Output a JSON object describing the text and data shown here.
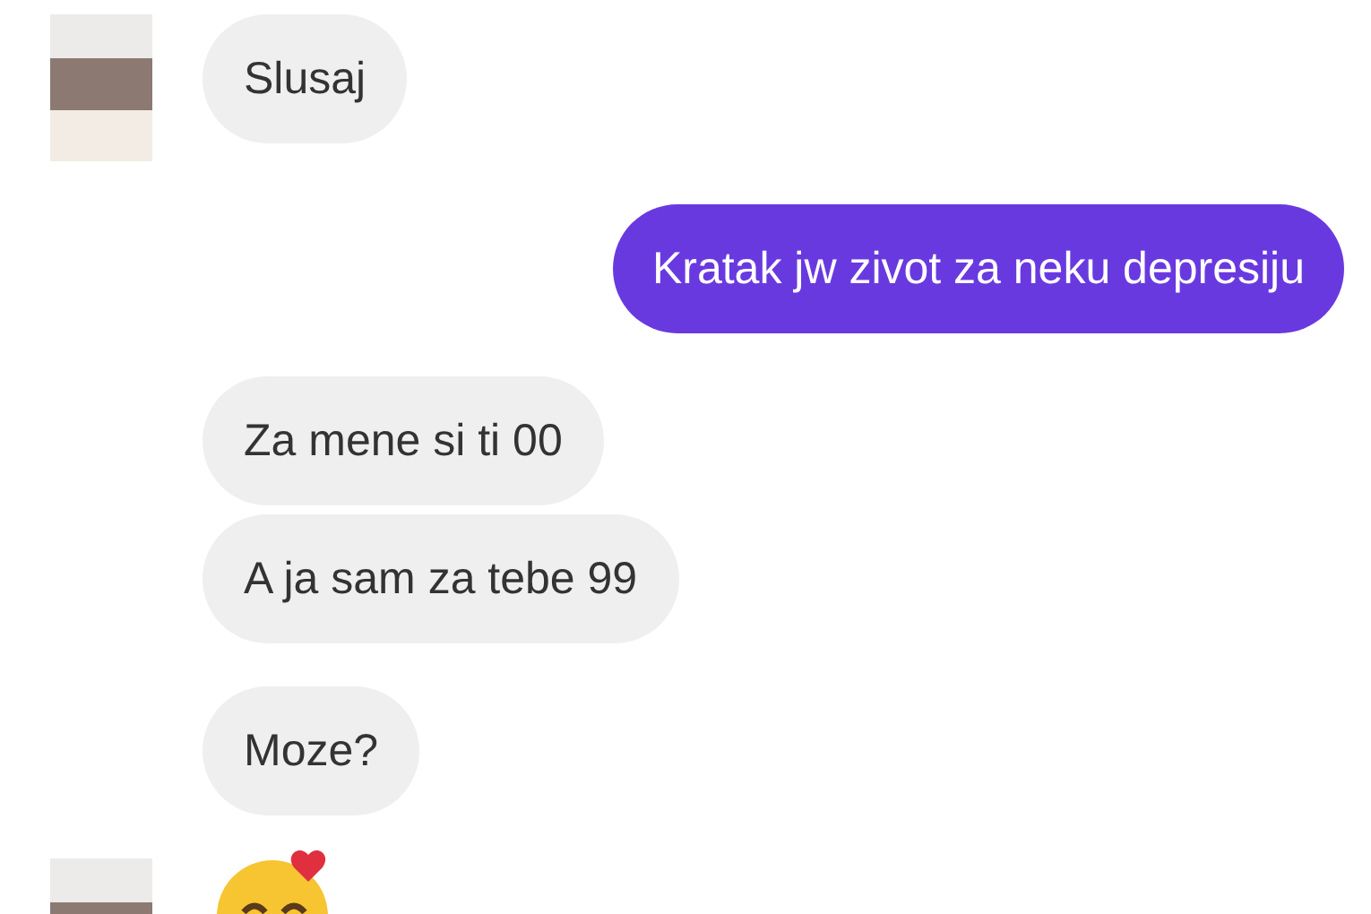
{
  "groups": [
    {
      "kind": "incoming",
      "avatar": true,
      "messages": [
        "Slusaj"
      ]
    },
    {
      "kind": "outgoing",
      "messages": [
        "Kratak jw zivot za neku depresiju"
      ]
    },
    {
      "kind": "incoming",
      "messages": [
        "Za mene si ti 00",
        "A ja sam za tebe 99"
      ]
    },
    {
      "kind": "incoming",
      "messages": [
        "Moze?"
      ]
    },
    {
      "kind": "emoji",
      "avatar": true
    }
  ]
}
